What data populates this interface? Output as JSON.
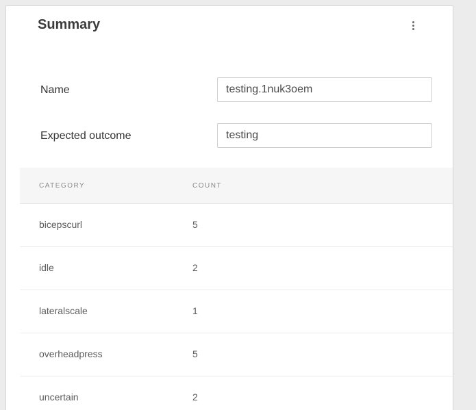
{
  "summary": {
    "title": "Summary",
    "menu_icon": "kebab-menu-icon"
  },
  "form": {
    "name_label": "Name",
    "name_value": "testing.1nuk3oem",
    "expected_label": "Expected outcome",
    "expected_value": "testing"
  },
  "table": {
    "headers": [
      "CATEGORY",
      "COUNT"
    ],
    "rows": [
      {
        "category": "bicepscurl",
        "count": "5"
      },
      {
        "category": "idle",
        "count": "2"
      },
      {
        "category": "lateralscale",
        "count": "1"
      },
      {
        "category": "overheadpress",
        "count": "5"
      },
      {
        "category": "uncertain",
        "count": "2"
      }
    ]
  }
}
